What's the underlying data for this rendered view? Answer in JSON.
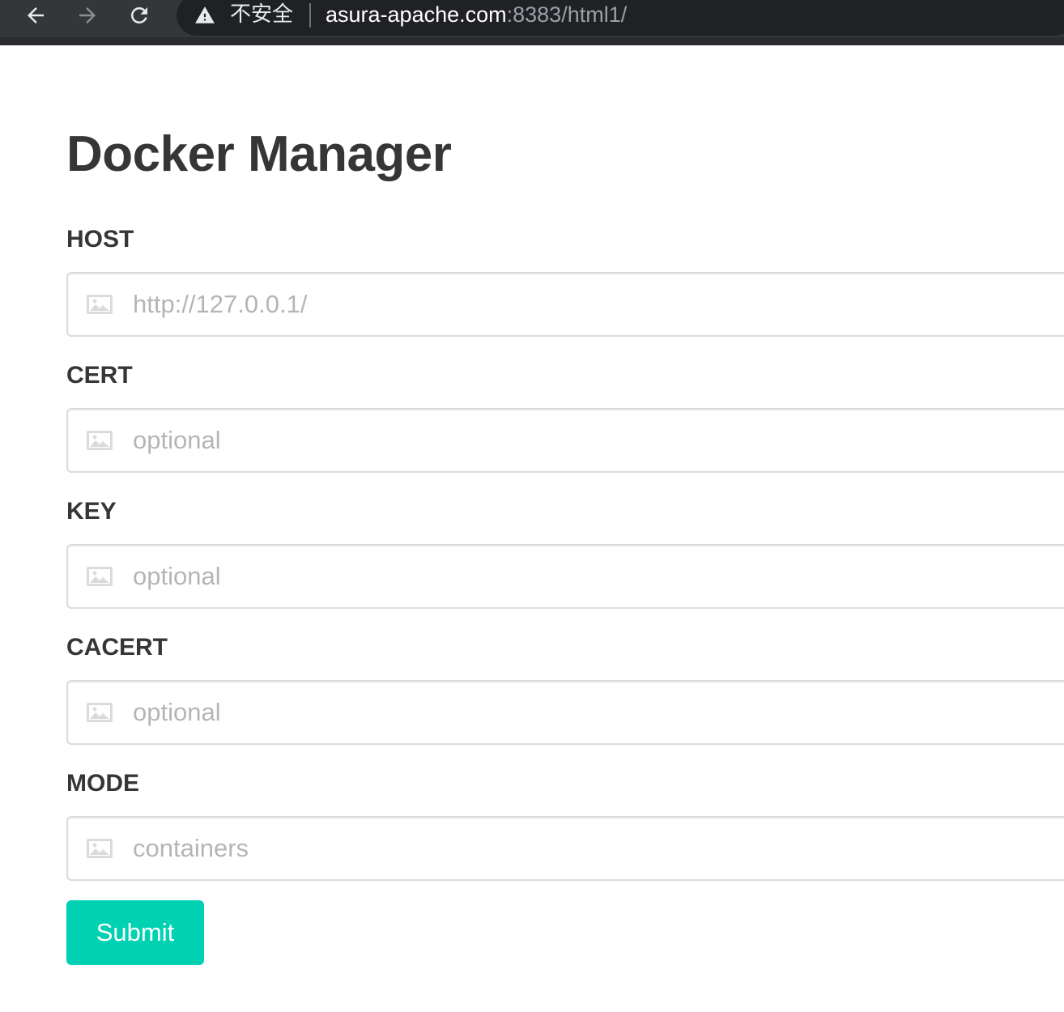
{
  "browser": {
    "security_label": "不安全",
    "url_host": "asura-apache.com",
    "url_rest": ":8383/html1/"
  },
  "page": {
    "title": "Docker Manager"
  },
  "form": {
    "fields": [
      {
        "label": "HOST",
        "placeholder": "http://127.0.0.1/",
        "icon": "image-icon"
      },
      {
        "label": "CERT",
        "placeholder": "optional",
        "icon": "image-icon"
      },
      {
        "label": "KEY",
        "placeholder": "optional",
        "icon": "image-icon"
      },
      {
        "label": "CACERT",
        "placeholder": "optional",
        "icon": "image-icon"
      },
      {
        "label": "MODE",
        "placeholder": "containers",
        "icon": "image-icon"
      }
    ],
    "submit_label": "Submit"
  },
  "colors": {
    "accent": "#00d1b2",
    "browser_chrome": "#35363a",
    "omnibox": "#202124",
    "text": "#363636",
    "placeholder": "#b5b5b5",
    "border": "#dbdbdb"
  }
}
